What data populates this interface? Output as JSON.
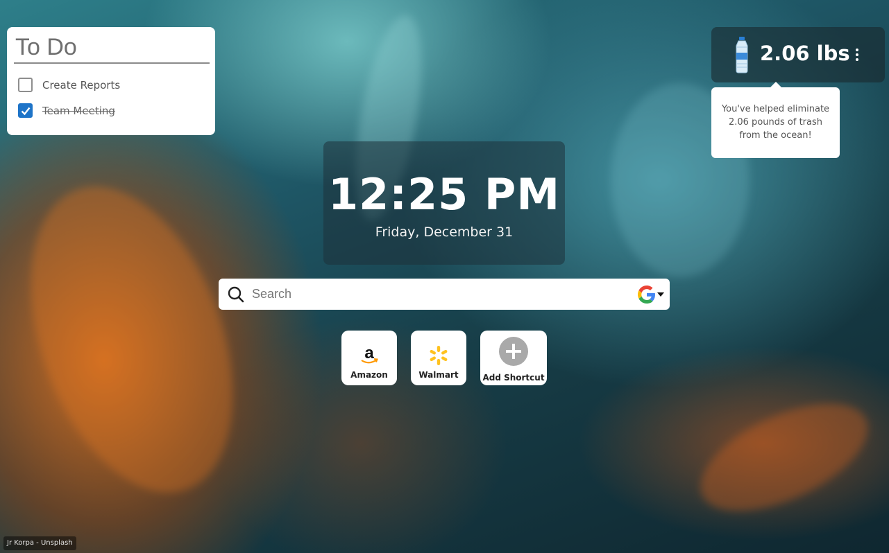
{
  "todo": {
    "title": "To Do",
    "items": [
      {
        "label": "Create Reports",
        "checked": false
      },
      {
        "label": "Team Meeting",
        "checked": true
      }
    ]
  },
  "clock": {
    "time": "12:25 PM",
    "date": "Friday, December 31"
  },
  "search": {
    "placeholder": "Search",
    "engine_icon": "google-icon"
  },
  "shortcuts": [
    {
      "label": "Amazon",
      "icon": "amazon-icon"
    },
    {
      "label": "Walmart",
      "icon": "walmart-icon"
    },
    {
      "label": "Add Shortcut",
      "icon": "plus-icon"
    }
  ],
  "impact": {
    "amount": "2.06 lbs",
    "tooltip": "You've helped eliminate 2.06 pounds of trash from the ocean!"
  },
  "photo_credit": "Jr Korpa - Unsplash",
  "colors": {
    "checkbox_accent": "#1e74c8",
    "walmart_yellow": "#ffc220",
    "amazon_orange": "#ff9900"
  }
}
